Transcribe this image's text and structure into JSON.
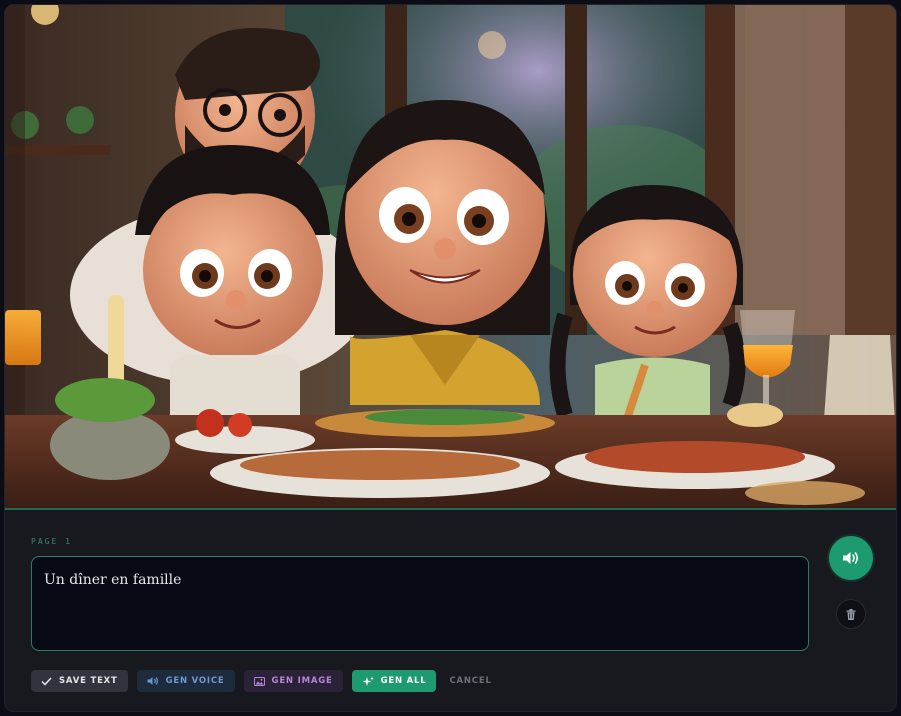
{
  "scene": {
    "description_icon": "family-dinner-illustration"
  },
  "page": {
    "label": "PAGE 1",
    "text_value": "Un dîner en famille"
  },
  "actions": {
    "save_text": "SAVE TEXT",
    "gen_voice": "GEN VOICE",
    "gen_image": "GEN IMAGE",
    "gen_all": "GEN ALL",
    "cancel": "CANCEL"
  },
  "side_buttons": {
    "voice_icon": "speaker-icon",
    "delete_icon": "trash-icon"
  },
  "colors": {
    "accent": "#1d9a70",
    "panel_bg": "#17191e",
    "textarea_border": "#2c7d68",
    "voice_btn_text": "#6e98d6",
    "image_btn_text": "#b388d8"
  }
}
